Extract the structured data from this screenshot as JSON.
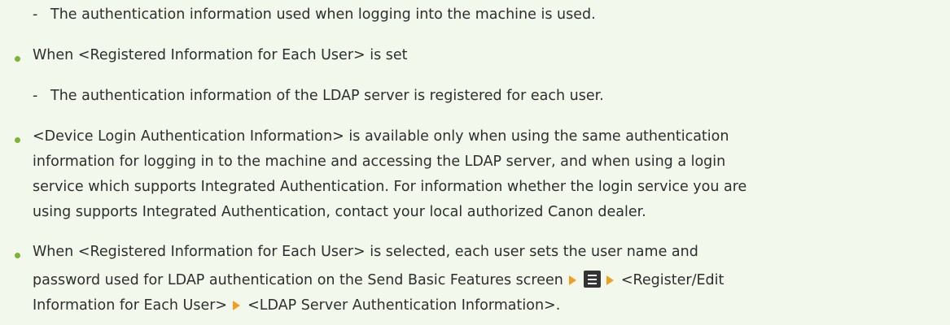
{
  "note": {
    "sub1": "The authentication information used when logging into the machine is used.",
    "bullet1": "When <Registered Information for Each User> is set",
    "sub2": "The authentication information of the LDAP server is registered for each user.",
    "bullet2": {
      "line1": "<Device Login Authentication Information> is available only when using the same authentication",
      "line2": "information for logging in to the machine and accessing the LDAP server, and when using a login",
      "line3": "service which supports Integrated Authentication. For information whether the login service you are",
      "line4": "using supports Integrated Authentication, contact your local authorized Canon dealer."
    },
    "bullet3": {
      "line1": "When <Registered Information for Each User> is selected, each user sets the user name and",
      "line2_part1": "password used for LDAP authentication on the Send Basic Features screen",
      "line2_part2": "<Register/Edit",
      "line3_part1": "Information for Each User>",
      "line3_part2": "<LDAP Server Authentication Information>."
    },
    "dash": "-",
    "colors": {
      "bullet": "#7ab531",
      "arrow": "#f0a020",
      "background": "#f3f8ec"
    },
    "icons": {
      "menu": "menu-icon",
      "arrow": "arrow-right-icon"
    }
  }
}
